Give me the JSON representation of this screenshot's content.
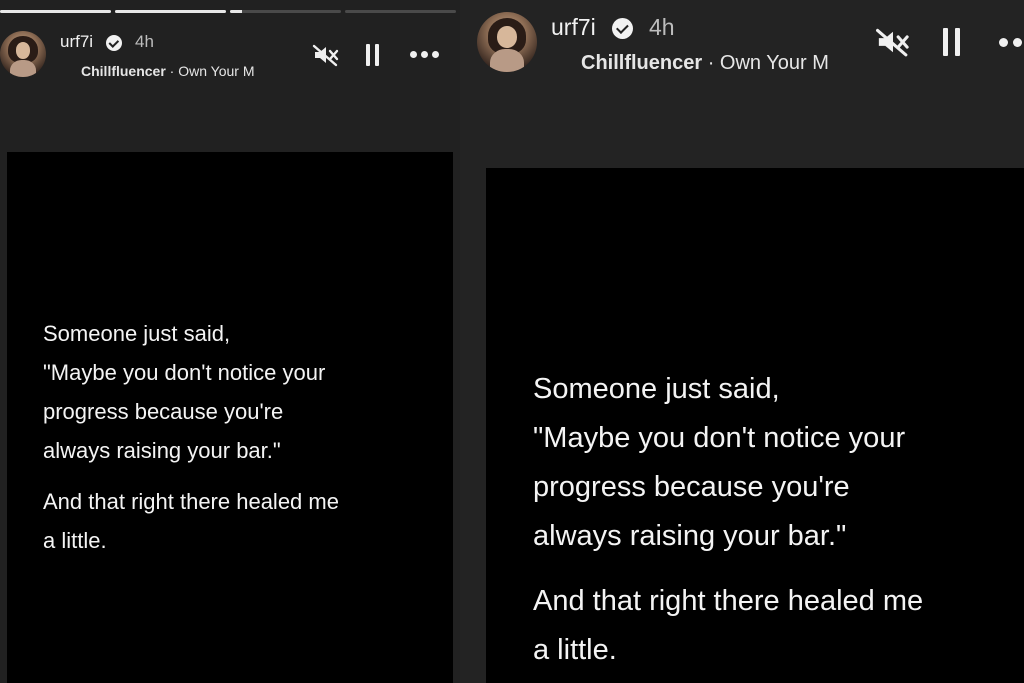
{
  "story": {
    "username": "urf7i",
    "time_ago": "4h",
    "subtitle_tag": "Chillfluencer",
    "subtitle_rest": " · Own Your M",
    "progress": {
      "segments_total": 4,
      "segments_complete": 2,
      "current_segment_fraction": 0.11
    },
    "icons": {
      "mute": "speaker-muted-icon",
      "pause": "pause-icon",
      "more": "more-options-icon",
      "verified": "verified-badge-icon"
    },
    "text": {
      "line1": "Someone just said,",
      "line2": "\"Maybe you don't notice your",
      "line3": "progress because you're",
      "line4": "always raising your bar.\"",
      "line5": "And that right there healed me",
      "line6": "a little."
    }
  },
  "colors": {
    "background": "#1f1f1f",
    "card": "#000000",
    "text": "#f4f4f4",
    "progress_fill": "#e8e8e8",
    "progress_track": "#4a4a4a"
  }
}
